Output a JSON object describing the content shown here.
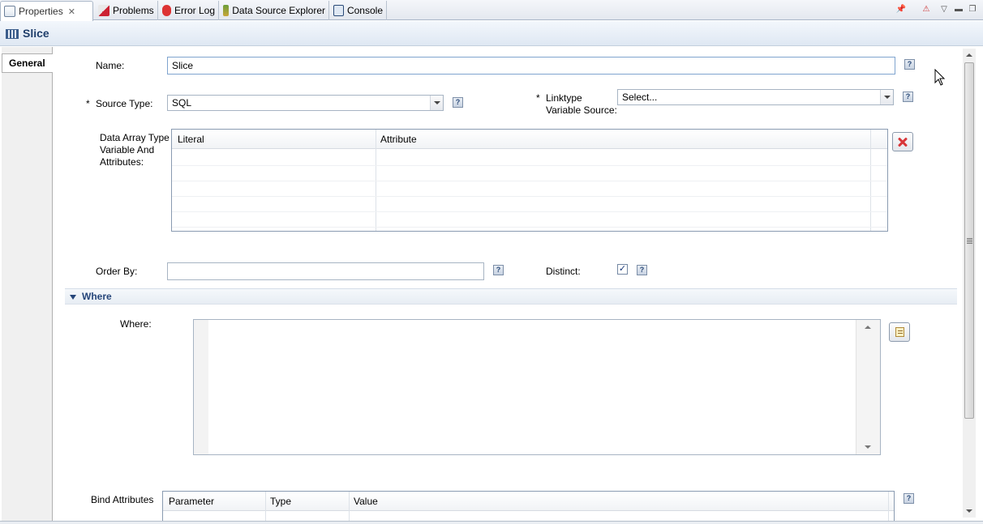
{
  "tabs": [
    {
      "label": "Properties",
      "icon": "properties-icon",
      "active": true
    },
    {
      "label": "Problems",
      "icon": "problems-icon"
    },
    {
      "label": "Error Log",
      "icon": "error-log-icon"
    },
    {
      "label": "Data Source Explorer",
      "icon": "data-source-explorer-icon"
    },
    {
      "label": "Console",
      "icon": "console-icon"
    }
  ],
  "header": {
    "title": "Slice",
    "icon": "slice-icon"
  },
  "sidebar": {
    "general_tab": "General"
  },
  "form": {
    "name_label": "Name:",
    "name_value": "Slice",
    "required_mark": "*",
    "source_type_label": "Source Type:",
    "source_type_value": "SQL",
    "linktype_label_1": "Linktype",
    "linktype_label_2": "Variable Source:",
    "linktype_value": "Select...",
    "data_array_label_1": "Data Array Type",
    "data_array_label_2": "Variable And",
    "data_array_label_3": "Attributes:",
    "data_array_columns": [
      "Literal",
      "Attribute"
    ],
    "order_by_label": "Order By:",
    "order_by_value": "",
    "distinct_label": "Distinct:",
    "distinct_checked": true,
    "help_glyph": "?"
  },
  "where_section": {
    "title": "Where",
    "where_label": "Where:",
    "where_value": ""
  },
  "bind_attributes": {
    "label": "Bind Attributes",
    "columns": [
      "Parameter",
      "Type",
      "Value"
    ]
  },
  "colors": {
    "accent": "#26467a",
    "delete": "#d8373a",
    "header_bg": "#dfe8f3"
  }
}
